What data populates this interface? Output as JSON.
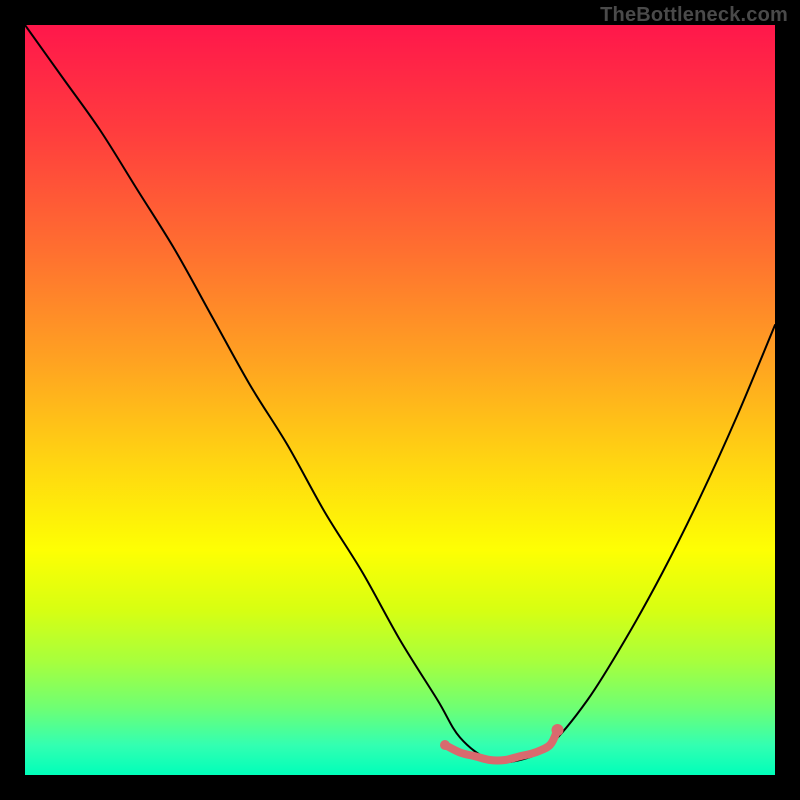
{
  "watermark": "TheBottleneck.com",
  "chart_data": {
    "type": "line",
    "title": "",
    "xlabel": "",
    "ylabel": "",
    "xlim": [
      0,
      100
    ],
    "ylim": [
      0,
      100
    ],
    "background_gradient": {
      "stops": [
        {
          "offset": 0.0,
          "color": "#ff174b"
        },
        {
          "offset": 0.14,
          "color": "#ff3c3e"
        },
        {
          "offset": 0.3,
          "color": "#ff6f30"
        },
        {
          "offset": 0.45,
          "color": "#ffa321"
        },
        {
          "offset": 0.58,
          "color": "#ffd412"
        },
        {
          "offset": 0.7,
          "color": "#feff03"
        },
        {
          "offset": 0.78,
          "color": "#d7ff12"
        },
        {
          "offset": 0.85,
          "color": "#a6ff3e"
        },
        {
          "offset": 0.91,
          "color": "#6fff73"
        },
        {
          "offset": 0.96,
          "color": "#33ffb1"
        },
        {
          "offset": 1.0,
          "color": "#00ffba"
        }
      ]
    },
    "series": [
      {
        "name": "bottleneck-curve",
        "type": "line",
        "color": "#000000",
        "x": [
          0,
          5,
          10,
          15,
          20,
          25,
          30,
          35,
          40,
          45,
          50,
          55,
          58,
          62,
          66,
          70,
          75,
          80,
          85,
          90,
          95,
          100
        ],
        "y": [
          100,
          93,
          86,
          78,
          70,
          61,
          52,
          44,
          35,
          27,
          18,
          10,
          5,
          2,
          2,
          4,
          10,
          18,
          27,
          37,
          48,
          60
        ]
      },
      {
        "name": "optimal-range",
        "type": "line",
        "color": "#d96a6e",
        "width": 8,
        "x": [
          56,
          58,
          60,
          62,
          64,
          66,
          68,
          70,
          71
        ],
        "y": [
          4,
          3,
          2.5,
          2,
          2,
          2.5,
          3,
          4,
          6
        ]
      }
    ],
    "endpoints": [
      {
        "x": 56,
        "y": 4,
        "r": 5,
        "color": "#d96a6e"
      },
      {
        "x": 71,
        "y": 6,
        "r": 6,
        "color": "#d96a6e"
      }
    ]
  }
}
